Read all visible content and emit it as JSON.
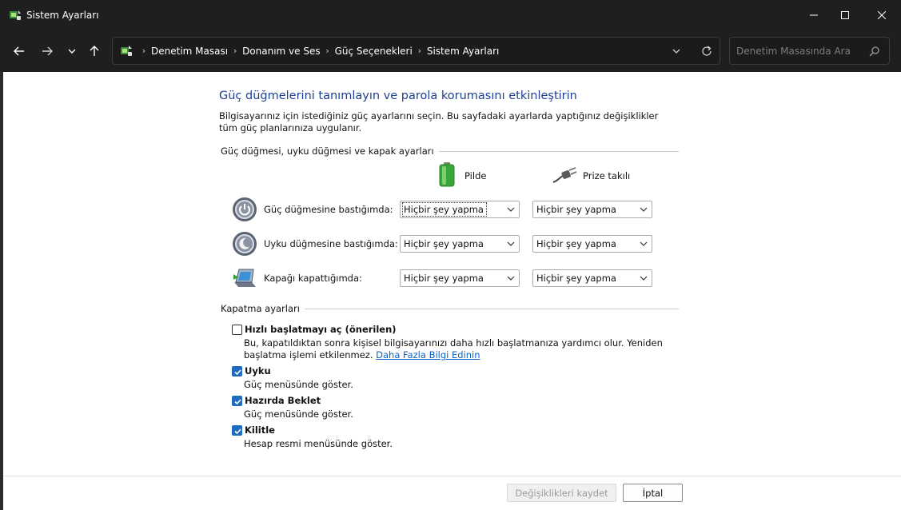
{
  "window": {
    "title": "Sistem Ayarları",
    "minimize_icon": "minimize-icon",
    "maximize_icon": "maximize-icon",
    "close_icon": "close-icon"
  },
  "nav": {
    "back_icon": "arrow-left-icon",
    "forward_icon": "arrow-right-icon",
    "recent_icon": "chevron-down-icon",
    "up_icon": "arrow-up-icon"
  },
  "breadcrumb": [
    "Denetim Masası",
    "Donanım ve Ses",
    "Güç Seçenekleri",
    "Sistem Ayarları"
  ],
  "search": {
    "placeholder": "Denetim Masasında Ara"
  },
  "page": {
    "heading": "Güç düğmelerini tanımlayın ve parola korumasını etkinleştirin",
    "description": "Bilgisayarınız için istediğiniz güç ayarlarını seçin. Bu sayfadaki ayarlarda yaptığınız değişiklikler tüm güç planlarınıza uygulanır."
  },
  "power_group": {
    "title": "Güç düğmesi, uyku düğmesi ve kapak ayarları",
    "col_battery": "Pilde",
    "col_plugged": "Prize takılı",
    "rows": [
      {
        "label": "Güç düğmesine bastığımda:",
        "battery": "Hiçbir şey yapma",
        "plugged": "Hiçbir şey yapma",
        "icon": "power-button-icon"
      },
      {
        "label": "Uyku düğmesine bastığımda:",
        "battery": "Hiçbir şey yapma",
        "plugged": "Hiçbir şey yapma",
        "icon": "sleep-button-icon"
      },
      {
        "label": "Kapağı kapattığımda:",
        "battery": "Hiçbir şey yapma",
        "plugged": "Hiçbir şey yapma",
        "icon": "laptop-lid-icon"
      }
    ]
  },
  "shutdown_group": {
    "title": "Kapatma ayarları",
    "options": [
      {
        "label": "Hızlı başlatmayı aç (önerilen)",
        "checked": false,
        "desc": "Bu, kapatıldıktan sonra kişisel bilgisayarınızı daha hızlı başlatmanıza yardımcı olur. Yeniden başlatma işlemi etkilenmez.",
        "link": "Daha Fazla Bilgi Edinin"
      },
      {
        "label": "Uyku",
        "checked": true,
        "desc": "Güç menüsünde göster."
      },
      {
        "label": "Hazırda Beklet",
        "checked": true,
        "desc": "Güç menüsünde göster."
      },
      {
        "label": "Kilitle",
        "checked": true,
        "desc": "Hesap resmi menüsünde göster."
      }
    ]
  },
  "buttons": {
    "save": "Değişiklikleri kaydet",
    "cancel": "İptal"
  },
  "colors": {
    "heading": "#1e3f8f",
    "link": "#0b62c4",
    "check_accent": "#1f6bbf",
    "chrome": "#1f1f1f"
  }
}
